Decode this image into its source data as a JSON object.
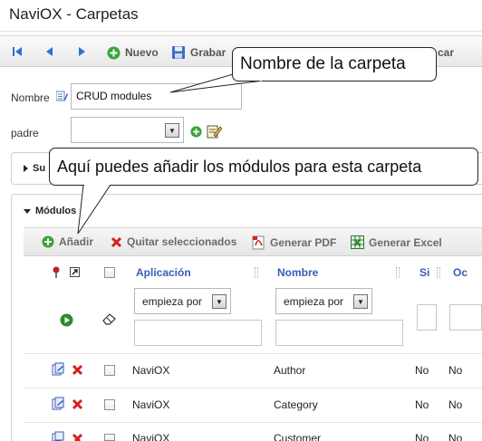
{
  "window": {
    "title": "NaviOX - Carpetas"
  },
  "toolbar": {
    "nuevo_label": "Nuevo",
    "grabar_label": "Grabar",
    "partial_label": "car"
  },
  "form": {
    "nombre_label": "Nombre",
    "nombre_value": "CRUD modules",
    "padre_label": "padre",
    "padre_value": ""
  },
  "sections": {
    "collapsed_label": "Su",
    "modulos_label": "Módulos"
  },
  "modulos_toolbar": {
    "add_label": "Añadir",
    "remove_label": "Quitar seleccionados",
    "pdf_label": "Generar PDF",
    "excel_label": "Generar Excel"
  },
  "grid": {
    "columns": [
      "Aplicación",
      "Nombre",
      "Si",
      "Oc"
    ],
    "filter_option": "empieza por",
    "rows": [
      {
        "aplicacion": "NaviOX",
        "nombre": "Author",
        "si": "No",
        "oc": "No"
      },
      {
        "aplicacion": "NaviOX",
        "nombre": "Category",
        "si": "No",
        "oc": "No"
      },
      {
        "aplicacion": "NaviOX",
        "nombre": "Customer",
        "si": "No",
        "oc": "No"
      }
    ]
  },
  "callouts": {
    "folder_name": "Nombre de la carpeta",
    "add_modules": "Aquí puedes añadir los módulos para esta carpeta"
  },
  "colors": {
    "header_link": "#3b5bb7",
    "nav_arrow": "#2f6fd6",
    "add_green": "#3aa33a",
    "remove_red": "#d42020"
  },
  "icons": [
    "first-icon",
    "previous-icon",
    "next-icon",
    "new-icon",
    "save-icon",
    "edit-list-icon",
    "add-icon",
    "edit-icon",
    "remove-icon",
    "pdf-icon",
    "excel-icon",
    "pin-icon",
    "maximize-icon",
    "play-icon",
    "eraser-icon",
    "open-row-icon",
    "delete-row-icon",
    "dropdown-icon"
  ]
}
